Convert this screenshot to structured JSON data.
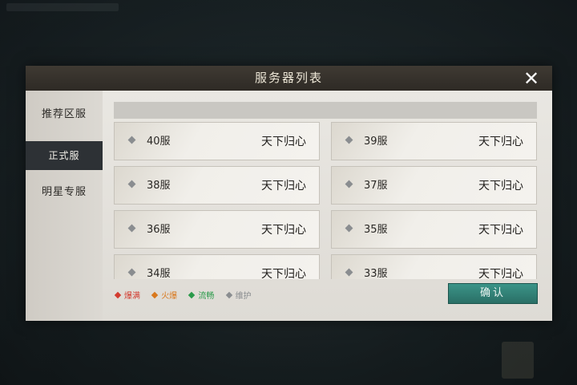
{
  "dialog": {
    "title": "服务器列表",
    "close_icon": "close-icon"
  },
  "tabs": [
    {
      "label": "推荐区服",
      "active": false
    },
    {
      "label": "正式服",
      "active": true
    },
    {
      "label": "明星专服",
      "active": false
    }
  ],
  "servers": [
    {
      "name": "40服",
      "zone": "天下归心",
      "status": "维护"
    },
    {
      "name": "39服",
      "zone": "天下归心",
      "status": "维护"
    },
    {
      "name": "38服",
      "zone": "天下归心",
      "status": "维护"
    },
    {
      "name": "37服",
      "zone": "天下归心",
      "status": "维护"
    },
    {
      "name": "36服",
      "zone": "天下归心",
      "status": "维护"
    },
    {
      "name": "35服",
      "zone": "天下归心",
      "status": "维护"
    },
    {
      "name": "34服",
      "zone": "天下归心",
      "status": "维护"
    },
    {
      "name": "33服",
      "zone": "天下归心",
      "status": "维护"
    }
  ],
  "legend": [
    {
      "label": "爆满",
      "color": "#d23b2f"
    },
    {
      "label": "火爆",
      "color": "#d9781d"
    },
    {
      "label": "流畅",
      "color": "#2a9a4a"
    },
    {
      "label": "维护",
      "color": "#8a8d90"
    }
  ],
  "confirm_label": "确认"
}
